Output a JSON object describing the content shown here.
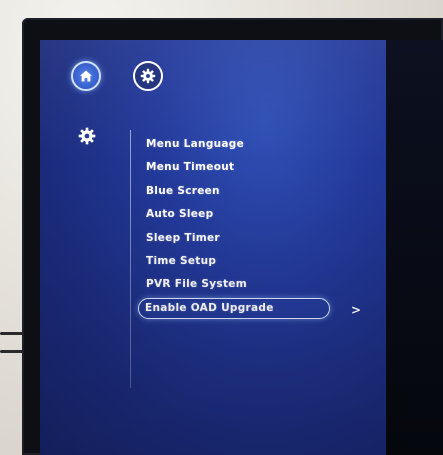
{
  "colors": {
    "menu_background": "#23399a",
    "text": "#ffffff",
    "selection_outline": "#dce6ff",
    "home_button_fill": "#2e57c8"
  },
  "top_nav": {
    "home_icon": "home-icon",
    "settings_icon": "gear-icon"
  },
  "sidebar": {
    "category_icon": "gear-icon"
  },
  "menu": {
    "items": [
      {
        "label": "Menu Language"
      },
      {
        "label": "Menu Timeout"
      },
      {
        "label": "Blue Screen"
      },
      {
        "label": "Auto Sleep"
      },
      {
        "label": "Sleep Timer"
      },
      {
        "label": "Time Setup"
      },
      {
        "label": "PVR File System"
      },
      {
        "label": "Enable OAD Upgrade"
      }
    ],
    "selected_index": 7,
    "submenu_indicator": ">"
  }
}
